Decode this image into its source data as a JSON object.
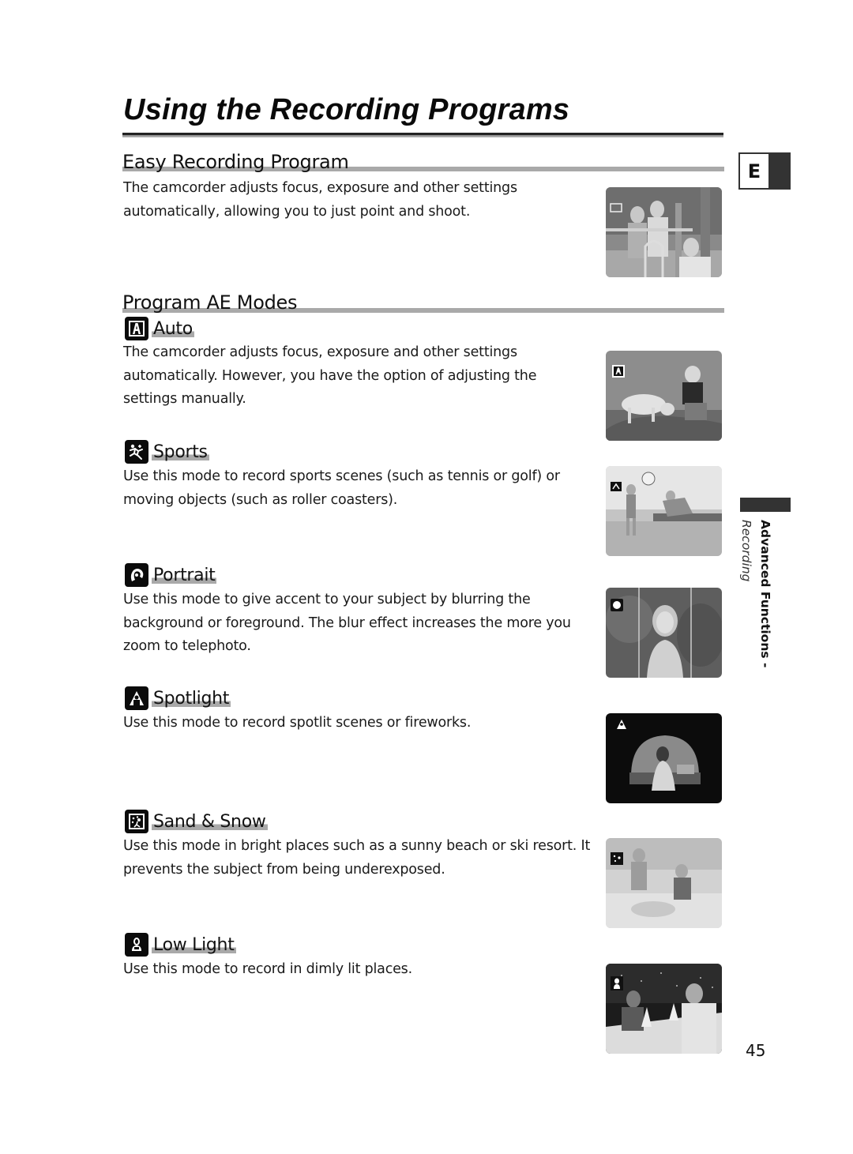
{
  "page": {
    "title": "Using the Recording Programs",
    "page_number": "45",
    "language_tab": "E",
    "side_tab": {
      "section": "Advanced Functions -",
      "subsection": "Recording"
    }
  },
  "easy_recording": {
    "heading": "Easy Recording Program",
    "lines": [
      "The camcorder adjusts focus, exposure and other settings",
      "automatically, allowing you to just point and shoot."
    ],
    "photo": "photo-family-playground"
  },
  "program_ae": {
    "heading": "Program AE Modes",
    "modes": [
      {
        "id": "auto",
        "label": "Auto",
        "icon": "auto-mode-icon",
        "lines": [
          "The camcorder adjusts focus, exposure and other settings",
          "automatically. However, you have the option of adjusting the",
          "settings manually."
        ],
        "photo": "photo-boy-and-dog"
      },
      {
        "id": "sports",
        "label": "Sports",
        "icon": "sports-mode-icon",
        "lines": [
          "Use this mode to record sports scenes (such as tennis or golf) or",
          "moving objects (such as roller coasters)."
        ],
        "photo": "photo-beach-volleyball"
      },
      {
        "id": "portrait",
        "label": "Portrait",
        "icon": "portrait-mode-icon",
        "lines": [
          "Use this mode to give accent to your subject by blurring the",
          "background or foreground. The blur effect increases the more you",
          "zoom to telephoto."
        ],
        "photo": "photo-girl-on-swing"
      },
      {
        "id": "spotlight",
        "label": "Spotlight",
        "icon": "spotlight-mode-icon",
        "lines": [
          "Use this mode to record spotlit scenes or fireworks."
        ],
        "photo": "photo-stage-performer"
      },
      {
        "id": "sand-snow",
        "label": "Sand & Snow",
        "icon": "sand-snow-mode-icon",
        "lines": [
          "Use this mode in bright places such as a sunny beach or ski resort. It",
          "prevents the subject from being underexposed."
        ],
        "photo": "photo-kids-on-beach"
      },
      {
        "id": "low-light",
        "label": "Low Light",
        "icon": "low-light-mode-icon",
        "lines": [
          "Use this mode to record in dimly lit places."
        ],
        "photo": "photo-dinner-couple"
      }
    ]
  }
}
